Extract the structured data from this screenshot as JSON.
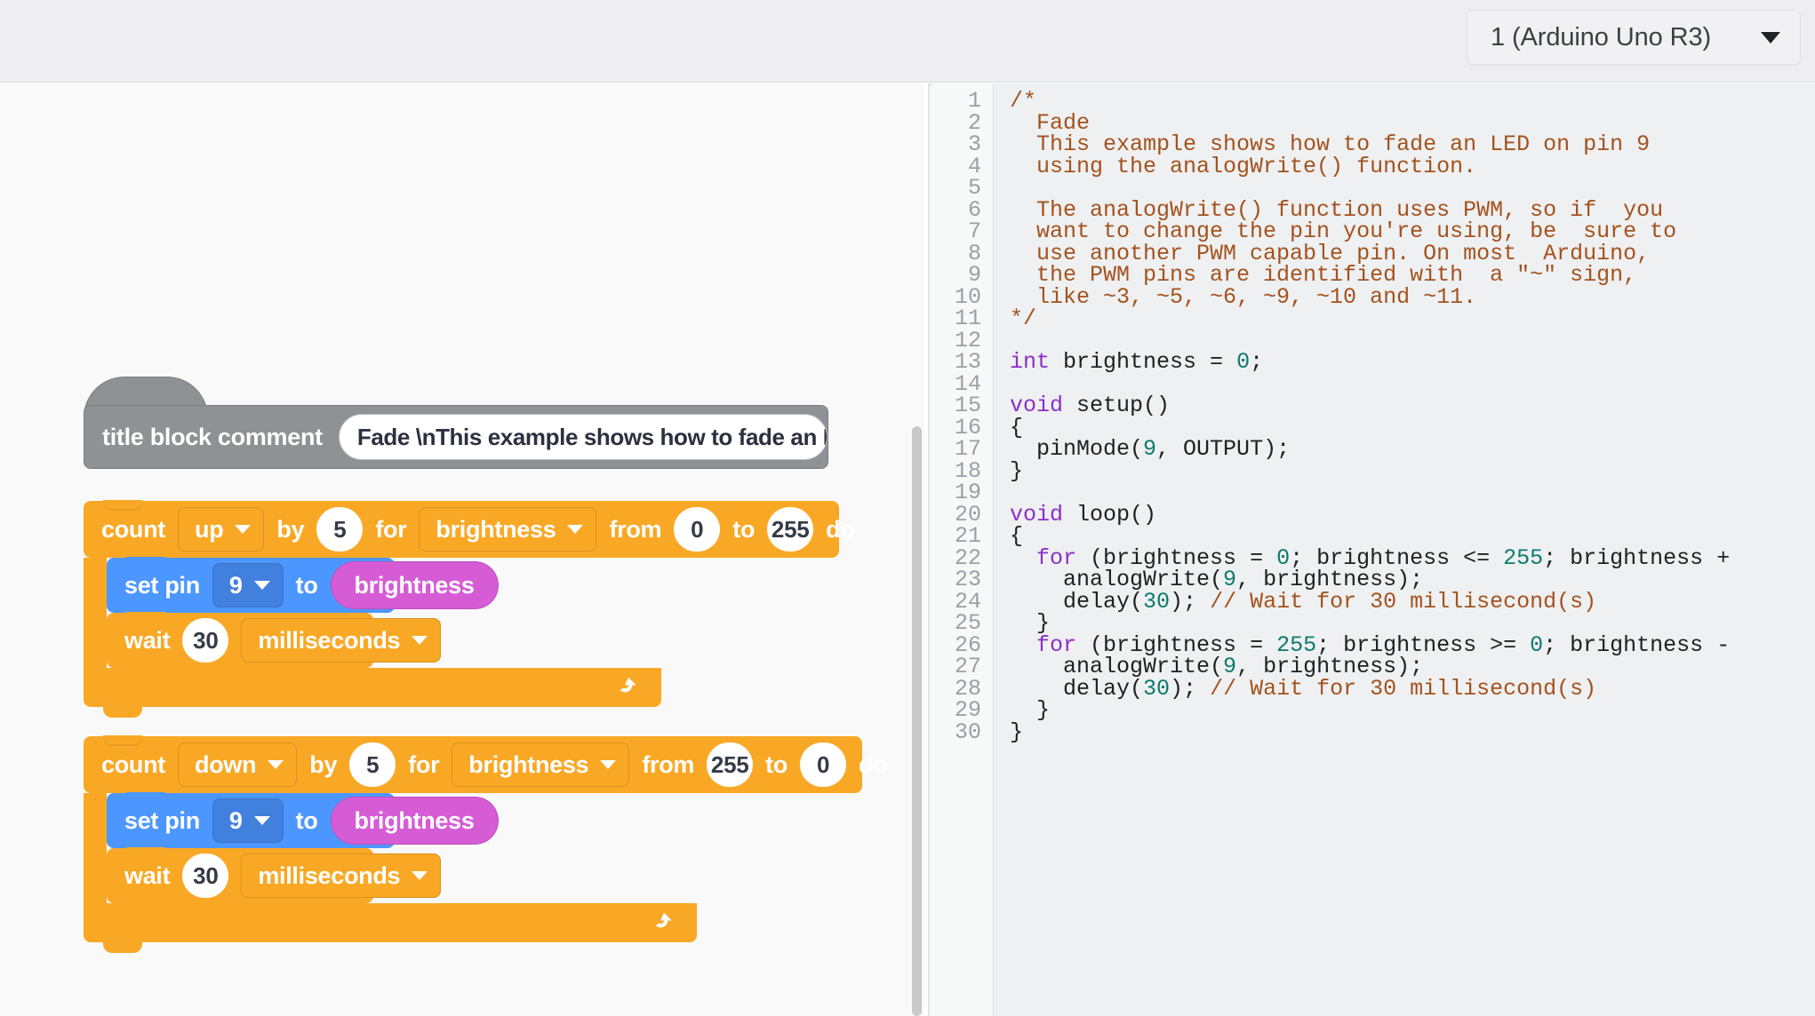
{
  "header": {
    "board_selector": {
      "value": "1 (Arduino Uno R3)",
      "caret_icon": "chevron-down-icon"
    }
  },
  "blocks_workspace": {
    "comment_block": {
      "label": "title block comment",
      "field_value": "Fade \\nThis example shows how to fade an LED o..."
    },
    "loops": [
      {
        "count_label": "count",
        "direction": "up",
        "by_label": "by",
        "step": "5",
        "for_label": "for",
        "variable": "brightness",
        "from_label": "from",
        "from_value": "0",
        "to_label": "to",
        "to_value": "255",
        "do_label": "do",
        "loop_arrow_icon": "loop-arrow-icon",
        "children": [
          {
            "type": "set-pin",
            "label": "set pin",
            "pin": "9",
            "to_label": "to",
            "value_variable": "brightness"
          },
          {
            "type": "wait",
            "label": "wait",
            "amount": "30",
            "unit": "milliseconds"
          }
        ]
      },
      {
        "count_label": "count",
        "direction": "down",
        "by_label": "by",
        "step": "5",
        "for_label": "for",
        "variable": "brightness",
        "from_label": "from",
        "from_value": "255",
        "to_label": "to",
        "to_value": "0",
        "do_label": "do",
        "loop_arrow_icon": "loop-arrow-icon",
        "children": [
          {
            "type": "set-pin",
            "label": "set pin",
            "pin": "9",
            "to_label": "to",
            "value_variable": "brightness"
          },
          {
            "type": "wait",
            "label": "wait",
            "amount": "30",
            "unit": "milliseconds"
          }
        ]
      }
    ],
    "scrollbar": {
      "name": "vertical-scrollbar"
    }
  },
  "code_editor": {
    "line_numbers": [
      1,
      2,
      3,
      4,
      5,
      6,
      7,
      8,
      9,
      10,
      11,
      12,
      13,
      14,
      15,
      16,
      17,
      18,
      19,
      20,
      21,
      22,
      23,
      24,
      25,
      26,
      27,
      28,
      29,
      30
    ],
    "lines": [
      {
        "n": 1,
        "tokens": [
          {
            "t": "comment",
            "s": "/*"
          }
        ]
      },
      {
        "n": 2,
        "tokens": [
          {
            "t": "comment",
            "s": "  Fade"
          }
        ]
      },
      {
        "n": 3,
        "tokens": [
          {
            "t": "comment",
            "s": "  This example shows how to fade an LED on pin 9"
          }
        ]
      },
      {
        "n": 4,
        "tokens": [
          {
            "t": "comment",
            "s": "  using the analogWrite() function."
          }
        ]
      },
      {
        "n": 5,
        "tokens": [
          {
            "t": "comment",
            "s": ""
          }
        ]
      },
      {
        "n": 6,
        "tokens": [
          {
            "t": "comment",
            "s": "  The analogWrite() function uses PWM, so if  you"
          }
        ]
      },
      {
        "n": 7,
        "tokens": [
          {
            "t": "comment",
            "s": "  want to change the pin you're using, be  sure to"
          }
        ]
      },
      {
        "n": 8,
        "tokens": [
          {
            "t": "comment",
            "s": "  use another PWM capable pin. On most  Arduino,"
          }
        ]
      },
      {
        "n": 9,
        "tokens": [
          {
            "t": "comment",
            "s": "  the PWM pins are identified with  a \"~\" sign,"
          }
        ]
      },
      {
        "n": 10,
        "tokens": [
          {
            "t": "comment",
            "s": "  like ~3, ~5, ~6, ~9, ~10 and ~11."
          }
        ]
      },
      {
        "n": 11,
        "tokens": [
          {
            "t": "comment",
            "s": "*/"
          }
        ]
      },
      {
        "n": 12,
        "tokens": [
          {
            "t": "plain",
            "s": ""
          }
        ]
      },
      {
        "n": 13,
        "tokens": [
          {
            "t": "keyword",
            "s": "int"
          },
          {
            "t": "plain",
            "s": " brightness = "
          },
          {
            "t": "number",
            "s": "0"
          },
          {
            "t": "plain",
            "s": ";"
          }
        ]
      },
      {
        "n": 14,
        "tokens": [
          {
            "t": "plain",
            "s": ""
          }
        ]
      },
      {
        "n": 15,
        "tokens": [
          {
            "t": "keyword",
            "s": "void"
          },
          {
            "t": "plain",
            "s": " setup()"
          }
        ]
      },
      {
        "n": 16,
        "tokens": [
          {
            "t": "plain",
            "s": "{"
          }
        ]
      },
      {
        "n": 17,
        "tokens": [
          {
            "t": "plain",
            "s": "  pinMode("
          },
          {
            "t": "number",
            "s": "9"
          },
          {
            "t": "plain",
            "s": ", OUTPUT);"
          }
        ]
      },
      {
        "n": 18,
        "tokens": [
          {
            "t": "plain",
            "s": "}"
          }
        ]
      },
      {
        "n": 19,
        "tokens": [
          {
            "t": "plain",
            "s": ""
          }
        ]
      },
      {
        "n": 20,
        "tokens": [
          {
            "t": "keyword",
            "s": "void"
          },
          {
            "t": "plain",
            "s": " loop()"
          }
        ]
      },
      {
        "n": 21,
        "tokens": [
          {
            "t": "plain",
            "s": "{"
          }
        ]
      },
      {
        "n": 22,
        "tokens": [
          {
            "t": "plain",
            "s": "  "
          },
          {
            "t": "keyword",
            "s": "for"
          },
          {
            "t": "plain",
            "s": " (brightness = "
          },
          {
            "t": "number",
            "s": "0"
          },
          {
            "t": "plain",
            "s": "; brightness <= "
          },
          {
            "t": "number",
            "s": "255"
          },
          {
            "t": "plain",
            "s": "; brightness +"
          }
        ]
      },
      {
        "n": 23,
        "tokens": [
          {
            "t": "plain",
            "s": "    analogWrite("
          },
          {
            "t": "number",
            "s": "9"
          },
          {
            "t": "plain",
            "s": ", brightness);"
          }
        ]
      },
      {
        "n": 24,
        "tokens": [
          {
            "t": "plain",
            "s": "    delay("
          },
          {
            "t": "number",
            "s": "30"
          },
          {
            "t": "plain",
            "s": "); "
          },
          {
            "t": "comment",
            "s": "// Wait for 30 millisecond(s)"
          }
        ]
      },
      {
        "n": 25,
        "tokens": [
          {
            "t": "plain",
            "s": "  }"
          }
        ]
      },
      {
        "n": 26,
        "tokens": [
          {
            "t": "plain",
            "s": "  "
          },
          {
            "t": "keyword",
            "s": "for"
          },
          {
            "t": "plain",
            "s": " (brightness = "
          },
          {
            "t": "number",
            "s": "255"
          },
          {
            "t": "plain",
            "s": "; brightness >= "
          },
          {
            "t": "number",
            "s": "0"
          },
          {
            "t": "plain",
            "s": "; brightness -"
          }
        ]
      },
      {
        "n": 27,
        "tokens": [
          {
            "t": "plain",
            "s": "    analogWrite("
          },
          {
            "t": "number",
            "s": "9"
          },
          {
            "t": "plain",
            "s": ", brightness);"
          }
        ]
      },
      {
        "n": 28,
        "tokens": [
          {
            "t": "plain",
            "s": "    delay("
          },
          {
            "t": "number",
            "s": "30"
          },
          {
            "t": "plain",
            "s": "); "
          },
          {
            "t": "comment",
            "s": "// Wait for 30 millisecond(s)"
          }
        ]
      },
      {
        "n": 29,
        "tokens": [
          {
            "t": "plain",
            "s": "  }"
          }
        ]
      },
      {
        "n": 30,
        "tokens": [
          {
            "t": "plain",
            "s": "}"
          }
        ]
      }
    ]
  },
  "colors": {
    "loop_block": "#f9a825",
    "set_pin_block": "#4c97ff",
    "variable_block": "#d65cd6",
    "comment_block": "#8f9194",
    "comment_token": "#a3521d",
    "keyword_token": "#8b2fc9",
    "number_token": "#0b7a6e",
    "header_bg": "#eeeef0",
    "code_bg": "#eff0f1"
  }
}
